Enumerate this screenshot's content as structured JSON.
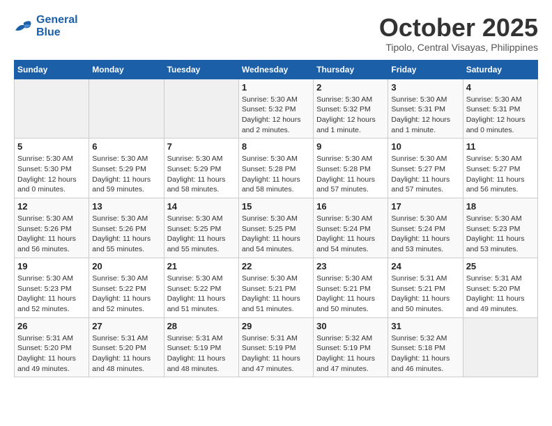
{
  "header": {
    "logo_line1": "General",
    "logo_line2": "Blue",
    "month": "October 2025",
    "location": "Tipolo, Central Visayas, Philippines"
  },
  "weekdays": [
    "Sunday",
    "Monday",
    "Tuesday",
    "Wednesday",
    "Thursday",
    "Friday",
    "Saturday"
  ],
  "weeks": [
    [
      {
        "day": "",
        "sunrise": "",
        "sunset": "",
        "daylight": ""
      },
      {
        "day": "",
        "sunrise": "",
        "sunset": "",
        "daylight": ""
      },
      {
        "day": "",
        "sunrise": "",
        "sunset": "",
        "daylight": ""
      },
      {
        "day": "1",
        "sunrise": "Sunrise: 5:30 AM",
        "sunset": "Sunset: 5:32 PM",
        "daylight": "Daylight: 12 hours and 2 minutes."
      },
      {
        "day": "2",
        "sunrise": "Sunrise: 5:30 AM",
        "sunset": "Sunset: 5:32 PM",
        "daylight": "Daylight: 12 hours and 1 minute."
      },
      {
        "day": "3",
        "sunrise": "Sunrise: 5:30 AM",
        "sunset": "Sunset: 5:31 PM",
        "daylight": "Daylight: 12 hours and 1 minute."
      },
      {
        "day": "4",
        "sunrise": "Sunrise: 5:30 AM",
        "sunset": "Sunset: 5:31 PM",
        "daylight": "Daylight: 12 hours and 0 minutes."
      }
    ],
    [
      {
        "day": "5",
        "sunrise": "Sunrise: 5:30 AM",
        "sunset": "Sunset: 5:30 PM",
        "daylight": "Daylight: 12 hours and 0 minutes."
      },
      {
        "day": "6",
        "sunrise": "Sunrise: 5:30 AM",
        "sunset": "Sunset: 5:29 PM",
        "daylight": "Daylight: 11 hours and 59 minutes."
      },
      {
        "day": "7",
        "sunrise": "Sunrise: 5:30 AM",
        "sunset": "Sunset: 5:29 PM",
        "daylight": "Daylight: 11 hours and 58 minutes."
      },
      {
        "day": "8",
        "sunrise": "Sunrise: 5:30 AM",
        "sunset": "Sunset: 5:28 PM",
        "daylight": "Daylight: 11 hours and 58 minutes."
      },
      {
        "day": "9",
        "sunrise": "Sunrise: 5:30 AM",
        "sunset": "Sunset: 5:28 PM",
        "daylight": "Daylight: 11 hours and 57 minutes."
      },
      {
        "day": "10",
        "sunrise": "Sunrise: 5:30 AM",
        "sunset": "Sunset: 5:27 PM",
        "daylight": "Daylight: 11 hours and 57 minutes."
      },
      {
        "day": "11",
        "sunrise": "Sunrise: 5:30 AM",
        "sunset": "Sunset: 5:27 PM",
        "daylight": "Daylight: 11 hours and 56 minutes."
      }
    ],
    [
      {
        "day": "12",
        "sunrise": "Sunrise: 5:30 AM",
        "sunset": "Sunset: 5:26 PM",
        "daylight": "Daylight: 11 hours and 56 minutes."
      },
      {
        "day": "13",
        "sunrise": "Sunrise: 5:30 AM",
        "sunset": "Sunset: 5:26 PM",
        "daylight": "Daylight: 11 hours and 55 minutes."
      },
      {
        "day": "14",
        "sunrise": "Sunrise: 5:30 AM",
        "sunset": "Sunset: 5:25 PM",
        "daylight": "Daylight: 11 hours and 55 minutes."
      },
      {
        "day": "15",
        "sunrise": "Sunrise: 5:30 AM",
        "sunset": "Sunset: 5:25 PM",
        "daylight": "Daylight: 11 hours and 54 minutes."
      },
      {
        "day": "16",
        "sunrise": "Sunrise: 5:30 AM",
        "sunset": "Sunset: 5:24 PM",
        "daylight": "Daylight: 11 hours and 54 minutes."
      },
      {
        "day": "17",
        "sunrise": "Sunrise: 5:30 AM",
        "sunset": "Sunset: 5:24 PM",
        "daylight": "Daylight: 11 hours and 53 minutes."
      },
      {
        "day": "18",
        "sunrise": "Sunrise: 5:30 AM",
        "sunset": "Sunset: 5:23 PM",
        "daylight": "Daylight: 11 hours and 53 minutes."
      }
    ],
    [
      {
        "day": "19",
        "sunrise": "Sunrise: 5:30 AM",
        "sunset": "Sunset: 5:23 PM",
        "daylight": "Daylight: 11 hours and 52 minutes."
      },
      {
        "day": "20",
        "sunrise": "Sunrise: 5:30 AM",
        "sunset": "Sunset: 5:22 PM",
        "daylight": "Daylight: 11 hours and 52 minutes."
      },
      {
        "day": "21",
        "sunrise": "Sunrise: 5:30 AM",
        "sunset": "Sunset: 5:22 PM",
        "daylight": "Daylight: 11 hours and 51 minutes."
      },
      {
        "day": "22",
        "sunrise": "Sunrise: 5:30 AM",
        "sunset": "Sunset: 5:21 PM",
        "daylight": "Daylight: 11 hours and 51 minutes."
      },
      {
        "day": "23",
        "sunrise": "Sunrise: 5:30 AM",
        "sunset": "Sunset: 5:21 PM",
        "daylight": "Daylight: 11 hours and 50 minutes."
      },
      {
        "day": "24",
        "sunrise": "Sunrise: 5:31 AM",
        "sunset": "Sunset: 5:21 PM",
        "daylight": "Daylight: 11 hours and 50 minutes."
      },
      {
        "day": "25",
        "sunrise": "Sunrise: 5:31 AM",
        "sunset": "Sunset: 5:20 PM",
        "daylight": "Daylight: 11 hours and 49 minutes."
      }
    ],
    [
      {
        "day": "26",
        "sunrise": "Sunrise: 5:31 AM",
        "sunset": "Sunset: 5:20 PM",
        "daylight": "Daylight: 11 hours and 49 minutes."
      },
      {
        "day": "27",
        "sunrise": "Sunrise: 5:31 AM",
        "sunset": "Sunset: 5:20 PM",
        "daylight": "Daylight: 11 hours and 48 minutes."
      },
      {
        "day": "28",
        "sunrise": "Sunrise: 5:31 AM",
        "sunset": "Sunset: 5:19 PM",
        "daylight": "Daylight: 11 hours and 48 minutes."
      },
      {
        "day": "29",
        "sunrise": "Sunrise: 5:31 AM",
        "sunset": "Sunset: 5:19 PM",
        "daylight": "Daylight: 11 hours and 47 minutes."
      },
      {
        "day": "30",
        "sunrise": "Sunrise: 5:32 AM",
        "sunset": "Sunset: 5:19 PM",
        "daylight": "Daylight: 11 hours and 47 minutes."
      },
      {
        "day": "31",
        "sunrise": "Sunrise: 5:32 AM",
        "sunset": "Sunset: 5:18 PM",
        "daylight": "Daylight: 11 hours and 46 minutes."
      },
      {
        "day": "",
        "sunrise": "",
        "sunset": "",
        "daylight": ""
      }
    ]
  ]
}
